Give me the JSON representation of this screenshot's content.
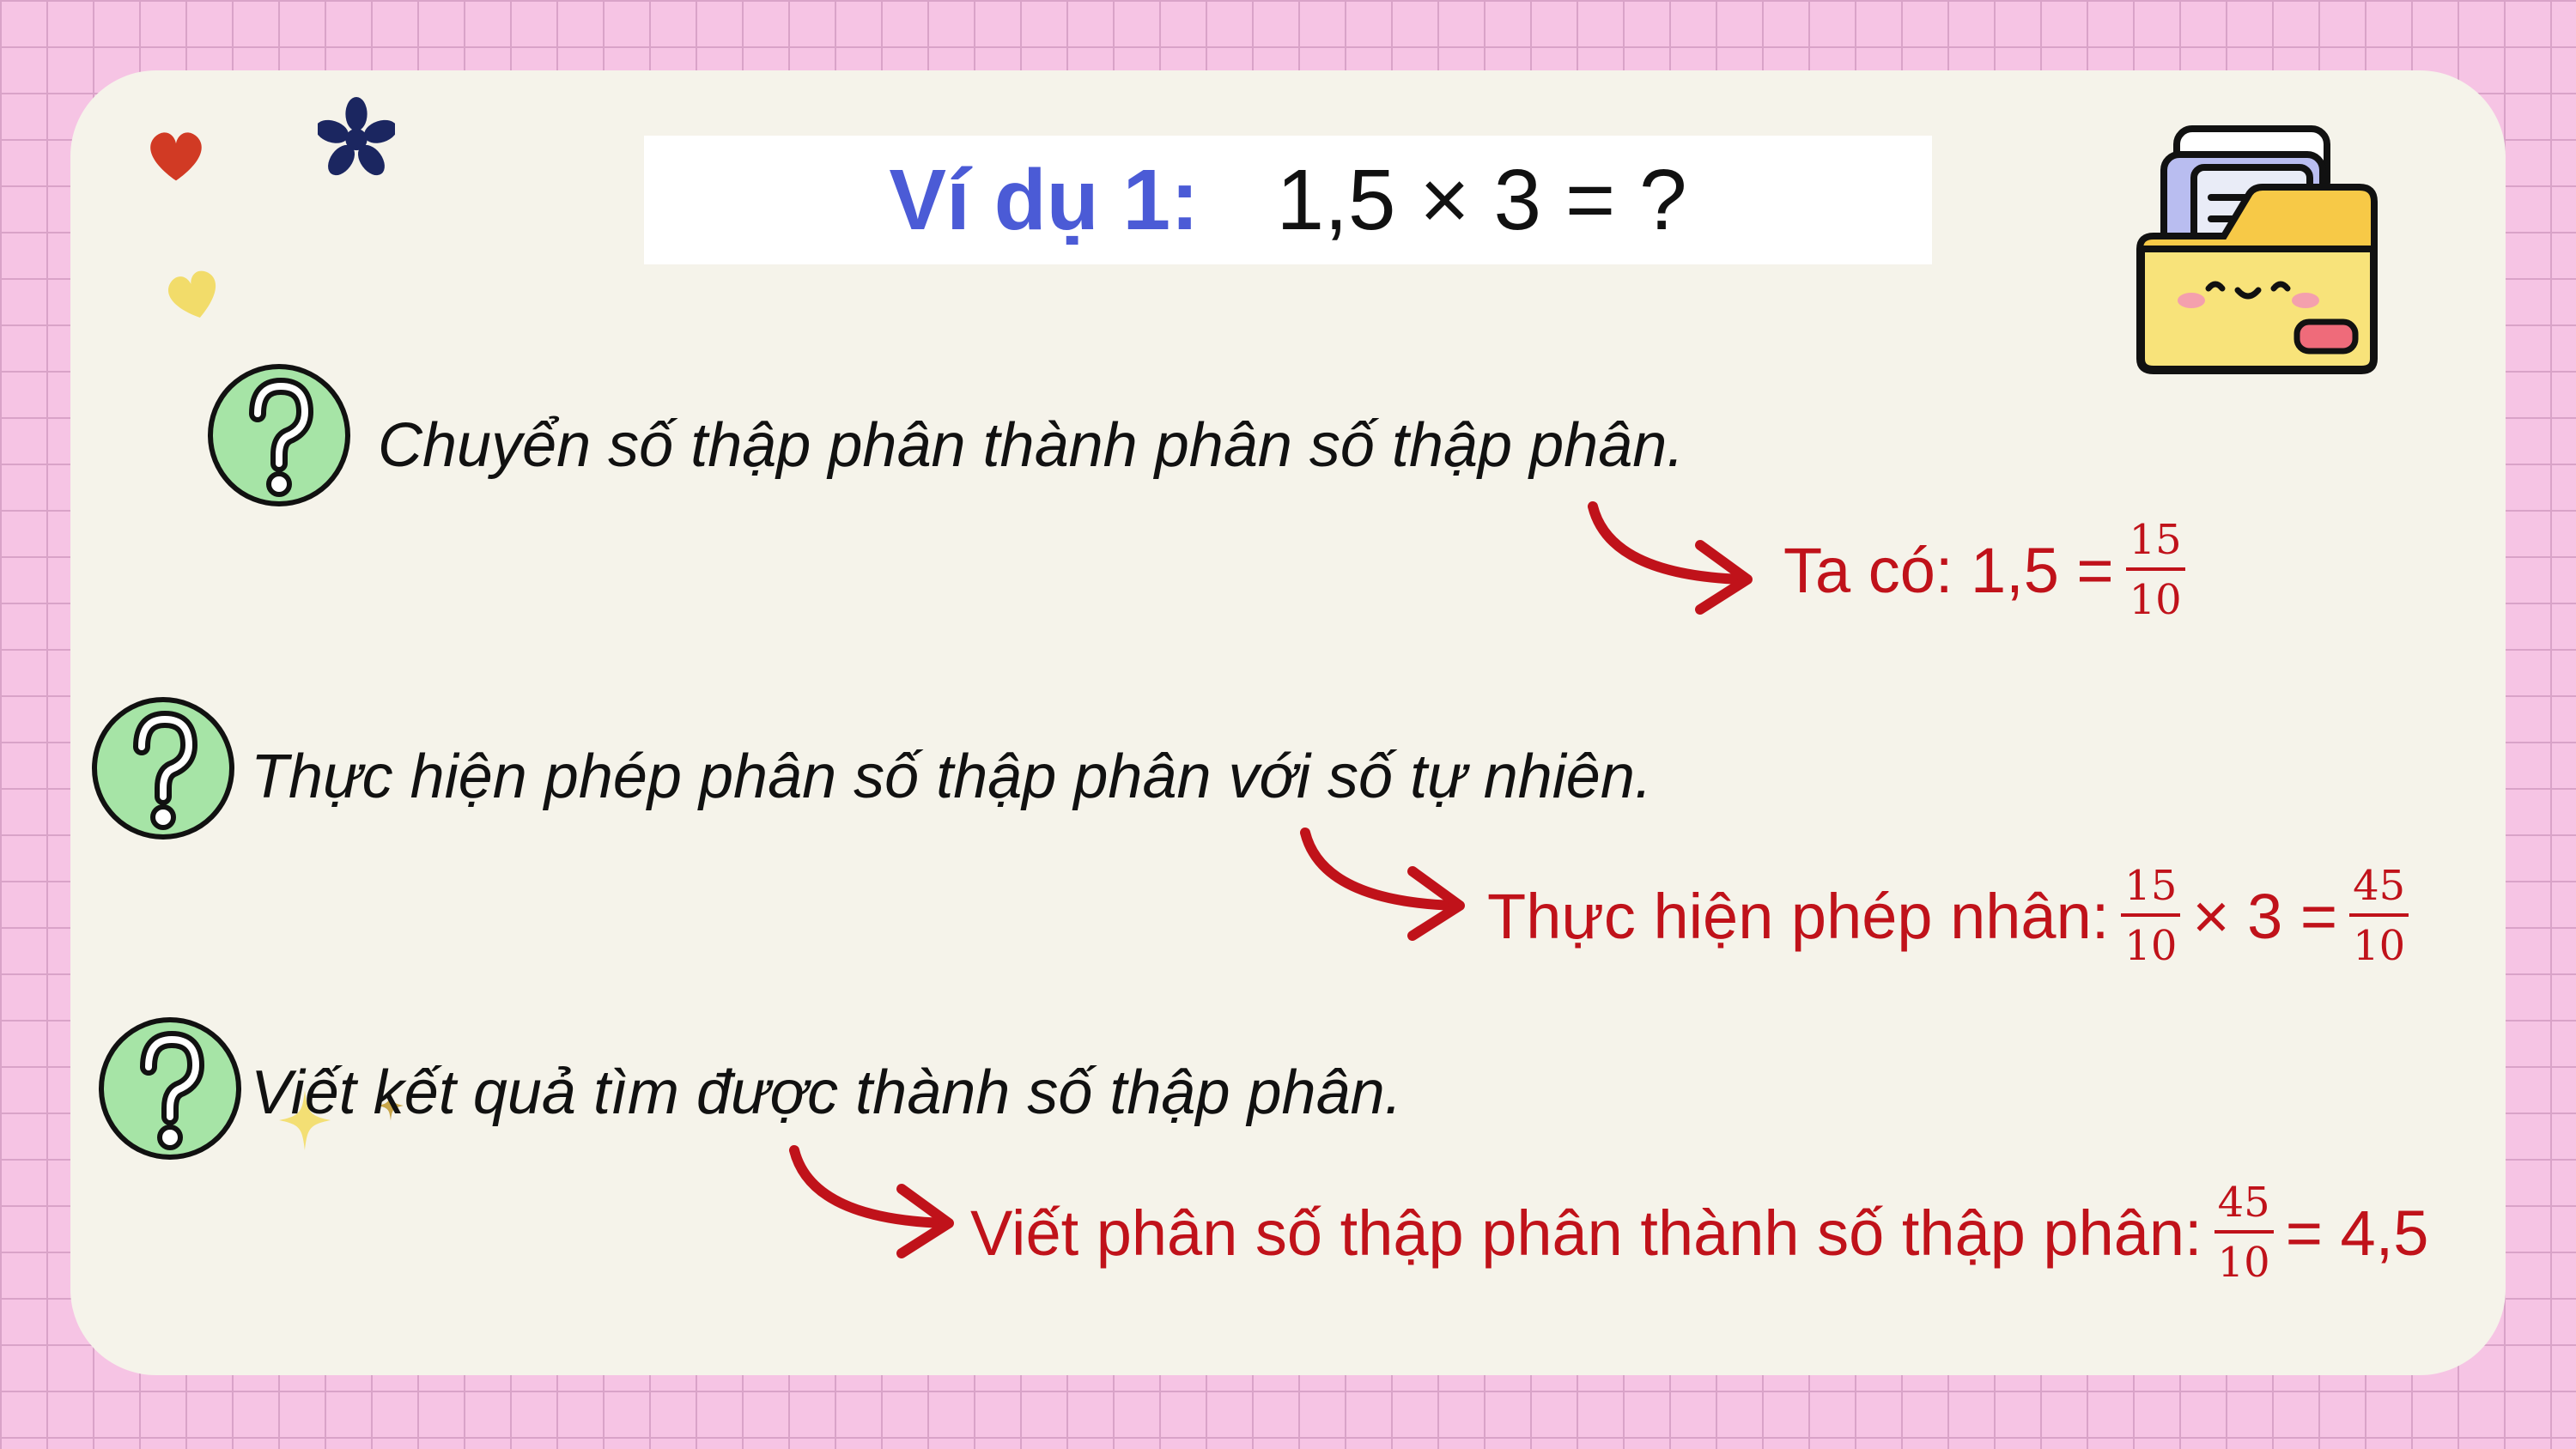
{
  "title": {
    "label": "Ví dụ 1:",
    "expression": "1,5 × 3 = ?"
  },
  "steps": [
    {
      "question": "Chuyển số thập phân thành phân số thập phân.",
      "answer": {
        "prefix": "Ta có: 1,5 =",
        "fraction": {
          "num": "15",
          "den": "10"
        }
      }
    },
    {
      "question": "Thực hiện phép phân số thập phân với số tự nhiên.",
      "answer": {
        "prefix": "Thực hiện phép nhân:",
        "fraction1": {
          "num": "15",
          "den": "10"
        },
        "middle": "× 3 =",
        "fraction2": {
          "num": "45",
          "den": "10"
        }
      }
    },
    {
      "question": "Viết kết quả tìm được thành số thập phân.",
      "answer": {
        "prefix": "Viết phân số thập phân thành số thập phân:",
        "fraction": {
          "num": "45",
          "den": "10"
        },
        "suffix": "= 4,5"
      }
    }
  ],
  "colors": {
    "title_label": "#4b5bd6",
    "answer": "#c0121a",
    "question_circle": "#a6e4a6",
    "background": "#f6c4e4",
    "card": "#f5f3ea"
  },
  "icons": [
    "heart-icon",
    "flower-icon",
    "question-mark-icon",
    "red-arrow-icon",
    "folder-mascot-icon",
    "sparkle-icon"
  ]
}
